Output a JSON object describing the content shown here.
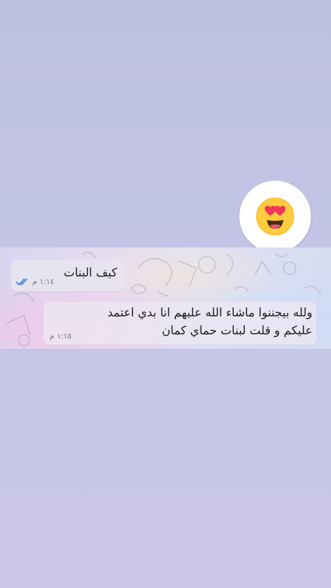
{
  "reaction": {
    "emoji": "😍",
    "icon": "heart-eyes-emoji-icon"
  },
  "messages": [
    {
      "direction": "outgoing",
      "text": "كيف البنات",
      "time": "١:١٤ م",
      "status_icon": "double-check-read-icon",
      "status_color": "#3b82d4"
    },
    {
      "direction": "incoming",
      "text": "ولله بيجننوا ماشاء الله عليهم انا بدي اعتمد عليكم و قلت لبنات حماي كمان",
      "time": "١:١٥ م"
    }
  ],
  "colors": {
    "background": "#c4c5e6",
    "bubble": "#ebe7f1",
    "read_check": "#3b82d4"
  }
}
